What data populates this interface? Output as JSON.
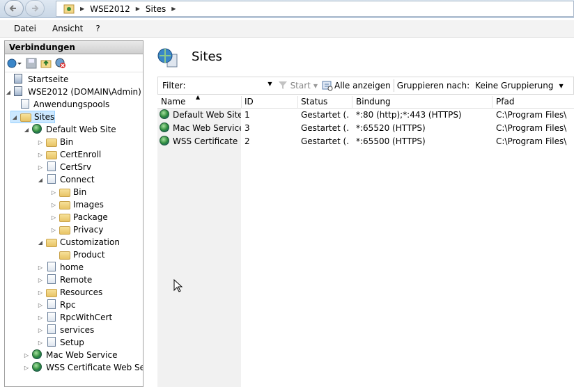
{
  "address": {
    "crumbs": [
      "WSE2012",
      "Sites"
    ]
  },
  "menu": [
    "Datei",
    "Ansicht",
    "?"
  ],
  "connections": {
    "title": "Verbindungen",
    "tree": [
      {
        "label": "Startseite",
        "icon": "start-page-icon",
        "level": 0,
        "expander": ""
      },
      {
        "label": "WSE2012 (DOMAIN\\Admin)",
        "icon": "server-icon",
        "level": 0,
        "expander": "◢"
      },
      {
        "label": "Anwendungspools",
        "icon": "app-pool-icon",
        "level": 1,
        "expander": ""
      },
      {
        "label": "Sites",
        "icon": "sites-folder-icon",
        "level": 1,
        "expander": "◢",
        "selected": true
      },
      {
        "label": "Default Web Site",
        "icon": "globe-icon",
        "level": 2,
        "expander": "◢"
      },
      {
        "label": "Bin",
        "icon": "folder-icon",
        "level": 3,
        "expander": "▷"
      },
      {
        "label": "CertEnroll",
        "icon": "folder-icon",
        "level": 3,
        "expander": "▷"
      },
      {
        "label": "CertSrv",
        "icon": "application-icon",
        "level": 3,
        "expander": "▷"
      },
      {
        "label": "Connect",
        "icon": "application-icon",
        "level": 3,
        "expander": "◢"
      },
      {
        "label": "Bin",
        "icon": "folder-icon",
        "level": 4,
        "expander": "▷"
      },
      {
        "label": "Images",
        "icon": "folder-icon",
        "level": 4,
        "expander": "▷"
      },
      {
        "label": "Package",
        "icon": "folder-icon",
        "level": 4,
        "expander": "▷"
      },
      {
        "label": "Privacy",
        "icon": "folder-icon",
        "level": 4,
        "expander": "▷"
      },
      {
        "label": "Customization",
        "icon": "folder-icon",
        "level": 3,
        "expander": "◢"
      },
      {
        "label": "Product",
        "icon": "folder-icon",
        "level": 4,
        "expander": ""
      },
      {
        "label": "home",
        "icon": "application-icon",
        "level": 3,
        "expander": "▷"
      },
      {
        "label": "Remote",
        "icon": "application-icon",
        "level": 3,
        "expander": "▷"
      },
      {
        "label": "Resources",
        "icon": "folder-icon",
        "level": 3,
        "expander": "▷"
      },
      {
        "label": "Rpc",
        "icon": "application-icon",
        "level": 3,
        "expander": "▷"
      },
      {
        "label": "RpcWithCert",
        "icon": "application-icon",
        "level": 3,
        "expander": "▷"
      },
      {
        "label": "services",
        "icon": "application-icon",
        "level": 3,
        "expander": "▷"
      },
      {
        "label": "Setup",
        "icon": "application-icon",
        "level": 3,
        "expander": "▷"
      },
      {
        "label": "Mac Web Service",
        "icon": "globe-icon",
        "level": 2,
        "expander": "▷"
      },
      {
        "label": "WSS Certificate Web Servi",
        "icon": "globe-icon",
        "level": 2,
        "expander": "▷"
      }
    ]
  },
  "main": {
    "title": "Sites",
    "filter_label": "Filter:",
    "start_label": "Start",
    "show_all_label": "Alle anzeigen",
    "group_label": "Gruppieren nach:",
    "group_value": "Keine Gruppierung",
    "columns": [
      "Name",
      "ID",
      "Status",
      "Bindung",
      "Pfad"
    ],
    "rows": [
      {
        "name": "Default Web Site",
        "id": "1",
        "status": "Gestartet (...",
        "binding": "*:80 (http);*:443 (HTTPS)",
        "path": "C:\\Program Files\\"
      },
      {
        "name": "Mac Web Service",
        "id": "3",
        "status": "Gestartet (...",
        "binding": "*:65520 (HTTPS)",
        "path": "C:\\Program Files\\"
      },
      {
        "name": "WSS Certificate ...",
        "id": "2",
        "status": "Gestartet (...",
        "binding": "*:65500 (HTTPS)",
        "path": "C:\\Program Files\\"
      }
    ]
  }
}
